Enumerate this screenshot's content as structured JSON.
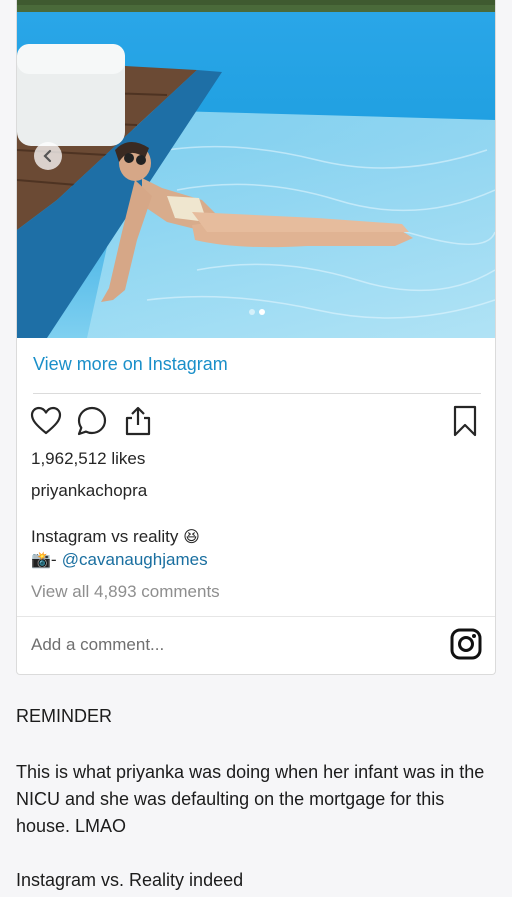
{
  "embed": {
    "view_more": "View more on Instagram",
    "likes": "1,962,512 likes",
    "username": "priyankachopra",
    "caption_line1": "Instagram vs reality",
    "caption_emoji": "😆",
    "caption_line2_prefix": "📸- ",
    "caption_mention": "@cavanaughjames",
    "view_comments": "View all 4,893 comments",
    "comment_placeholder": "Add a comment...",
    "carousel": {
      "slides": 2,
      "current": 2
    }
  },
  "post": {
    "reminder": "REMINDER",
    "paragraph": "This is what priyanka was doing when her infant was in the NICU and she was defaulting on the mortgage for this house. LMAO",
    "closing": "Instagram vs. Reality indeed"
  },
  "colors": {
    "link": "#1a8fc9",
    "pool_blue": "#1f9fe0",
    "background": "#f6f6f8"
  },
  "icons": [
    "chevron-left-icon",
    "heart-icon",
    "comment-icon",
    "share-icon",
    "bookmark-icon",
    "instagram-icon"
  ]
}
